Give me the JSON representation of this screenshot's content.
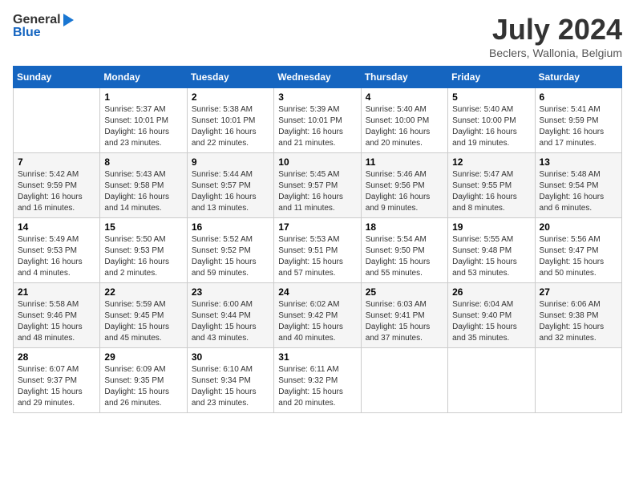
{
  "logo": {
    "general": "General",
    "blue": "Blue"
  },
  "title": "July 2024",
  "subtitle": "Beclers, Wallonia, Belgium",
  "columns": [
    "Sunday",
    "Monday",
    "Tuesday",
    "Wednesday",
    "Thursday",
    "Friday",
    "Saturday"
  ],
  "weeks": [
    [
      {
        "day": "",
        "info": ""
      },
      {
        "day": "1",
        "info": "Sunrise: 5:37 AM\nSunset: 10:01 PM\nDaylight: 16 hours\nand 23 minutes."
      },
      {
        "day": "2",
        "info": "Sunrise: 5:38 AM\nSunset: 10:01 PM\nDaylight: 16 hours\nand 22 minutes."
      },
      {
        "day": "3",
        "info": "Sunrise: 5:39 AM\nSunset: 10:01 PM\nDaylight: 16 hours\nand 21 minutes."
      },
      {
        "day": "4",
        "info": "Sunrise: 5:40 AM\nSunset: 10:00 PM\nDaylight: 16 hours\nand 20 minutes."
      },
      {
        "day": "5",
        "info": "Sunrise: 5:40 AM\nSunset: 10:00 PM\nDaylight: 16 hours\nand 19 minutes."
      },
      {
        "day": "6",
        "info": "Sunrise: 5:41 AM\nSunset: 9:59 PM\nDaylight: 16 hours\nand 17 minutes."
      }
    ],
    [
      {
        "day": "7",
        "info": "Sunrise: 5:42 AM\nSunset: 9:59 PM\nDaylight: 16 hours\nand 16 minutes."
      },
      {
        "day": "8",
        "info": "Sunrise: 5:43 AM\nSunset: 9:58 PM\nDaylight: 16 hours\nand 14 minutes."
      },
      {
        "day": "9",
        "info": "Sunrise: 5:44 AM\nSunset: 9:57 PM\nDaylight: 16 hours\nand 13 minutes."
      },
      {
        "day": "10",
        "info": "Sunrise: 5:45 AM\nSunset: 9:57 PM\nDaylight: 16 hours\nand 11 minutes."
      },
      {
        "day": "11",
        "info": "Sunrise: 5:46 AM\nSunset: 9:56 PM\nDaylight: 16 hours\nand 9 minutes."
      },
      {
        "day": "12",
        "info": "Sunrise: 5:47 AM\nSunset: 9:55 PM\nDaylight: 16 hours\nand 8 minutes."
      },
      {
        "day": "13",
        "info": "Sunrise: 5:48 AM\nSunset: 9:54 PM\nDaylight: 16 hours\nand 6 minutes."
      }
    ],
    [
      {
        "day": "14",
        "info": "Sunrise: 5:49 AM\nSunset: 9:53 PM\nDaylight: 16 hours\nand 4 minutes."
      },
      {
        "day": "15",
        "info": "Sunrise: 5:50 AM\nSunset: 9:53 PM\nDaylight: 16 hours\nand 2 minutes."
      },
      {
        "day": "16",
        "info": "Sunrise: 5:52 AM\nSunset: 9:52 PM\nDaylight: 15 hours\nand 59 minutes."
      },
      {
        "day": "17",
        "info": "Sunrise: 5:53 AM\nSunset: 9:51 PM\nDaylight: 15 hours\nand 57 minutes."
      },
      {
        "day": "18",
        "info": "Sunrise: 5:54 AM\nSunset: 9:50 PM\nDaylight: 15 hours\nand 55 minutes."
      },
      {
        "day": "19",
        "info": "Sunrise: 5:55 AM\nSunset: 9:48 PM\nDaylight: 15 hours\nand 53 minutes."
      },
      {
        "day": "20",
        "info": "Sunrise: 5:56 AM\nSunset: 9:47 PM\nDaylight: 15 hours\nand 50 minutes."
      }
    ],
    [
      {
        "day": "21",
        "info": "Sunrise: 5:58 AM\nSunset: 9:46 PM\nDaylight: 15 hours\nand 48 minutes."
      },
      {
        "day": "22",
        "info": "Sunrise: 5:59 AM\nSunset: 9:45 PM\nDaylight: 15 hours\nand 45 minutes."
      },
      {
        "day": "23",
        "info": "Sunrise: 6:00 AM\nSunset: 9:44 PM\nDaylight: 15 hours\nand 43 minutes."
      },
      {
        "day": "24",
        "info": "Sunrise: 6:02 AM\nSunset: 9:42 PM\nDaylight: 15 hours\nand 40 minutes."
      },
      {
        "day": "25",
        "info": "Sunrise: 6:03 AM\nSunset: 9:41 PM\nDaylight: 15 hours\nand 37 minutes."
      },
      {
        "day": "26",
        "info": "Sunrise: 6:04 AM\nSunset: 9:40 PM\nDaylight: 15 hours\nand 35 minutes."
      },
      {
        "day": "27",
        "info": "Sunrise: 6:06 AM\nSunset: 9:38 PM\nDaylight: 15 hours\nand 32 minutes."
      }
    ],
    [
      {
        "day": "28",
        "info": "Sunrise: 6:07 AM\nSunset: 9:37 PM\nDaylight: 15 hours\nand 29 minutes."
      },
      {
        "day": "29",
        "info": "Sunrise: 6:09 AM\nSunset: 9:35 PM\nDaylight: 15 hours\nand 26 minutes."
      },
      {
        "day": "30",
        "info": "Sunrise: 6:10 AM\nSunset: 9:34 PM\nDaylight: 15 hours\nand 23 minutes."
      },
      {
        "day": "31",
        "info": "Sunrise: 6:11 AM\nSunset: 9:32 PM\nDaylight: 15 hours\nand 20 minutes."
      },
      {
        "day": "",
        "info": ""
      },
      {
        "day": "",
        "info": ""
      },
      {
        "day": "",
        "info": ""
      }
    ]
  ]
}
